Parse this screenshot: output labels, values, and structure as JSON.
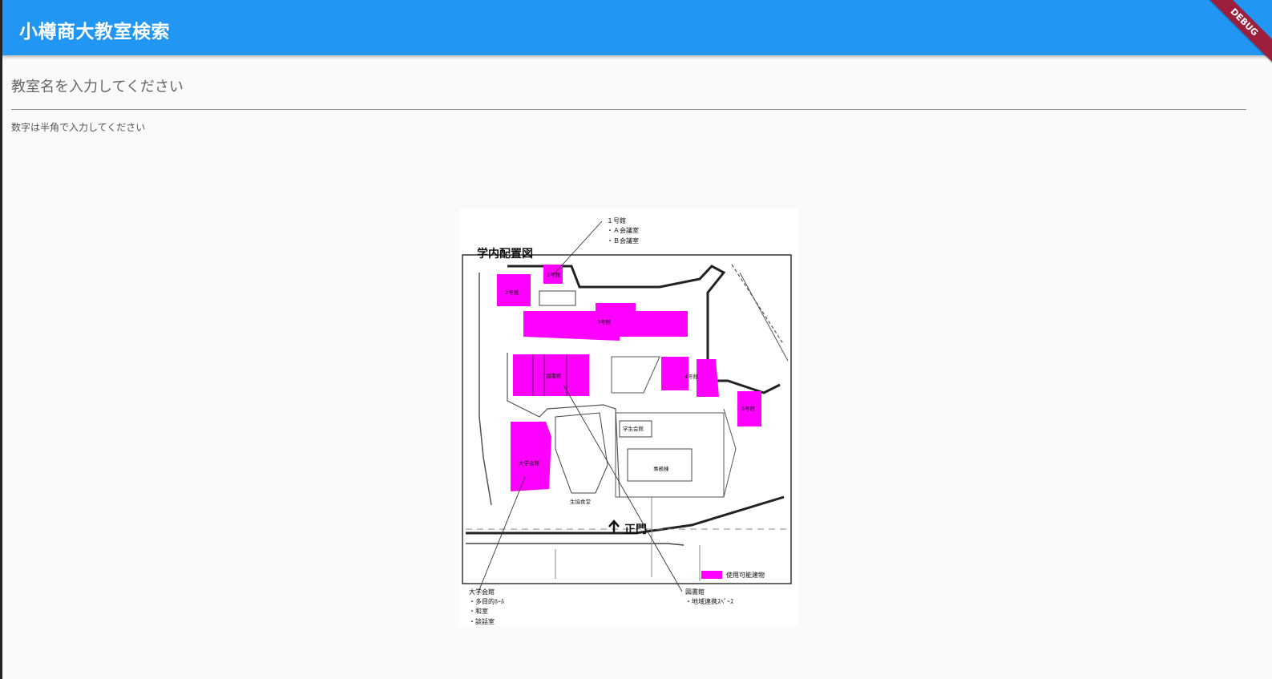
{
  "app": {
    "title": "小樽商大教室検索",
    "debug_label": "DEBUG"
  },
  "search": {
    "placeholder": "教室名を入力してください",
    "value": "",
    "helper": "数字は半角で入力してください"
  },
  "map": {
    "title": "学内配置図",
    "highlight_color": "#ff00ff",
    "buildings": {
      "b1": "1号館",
      "b2": "2号館",
      "b3": "3号館",
      "b4": "4号館",
      "b5": "5号館",
      "library": "図書館",
      "hall": "大学会館",
      "student_hall": "学生会館",
      "admin": "事務棟",
      "main_gate": "正門",
      "small_hall": "生協食堂"
    },
    "callouts": {
      "b1_title": "１号館",
      "b1_room_a": "・Ａ会議室",
      "b1_room_b": "・Ｂ会議室",
      "hall_title": "大学会館",
      "hall_item1": "・多目的ﾎｰﾙ",
      "hall_item2": "・和室",
      "hall_item3": "・談話室",
      "library_title": "図書館",
      "library_item1": "・地域連携ｽﾍﾟｰｽ"
    },
    "legend": "使用可能建物"
  }
}
